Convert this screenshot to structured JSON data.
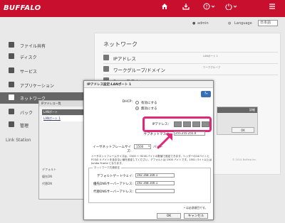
{
  "header": {
    "logo": "BUFFALO",
    "icons": [
      "home-icon",
      "download-icon",
      "help-icon",
      "power-icon"
    ],
    "user": "admin",
    "language_label": "Language",
    "language_value": "日本語"
  },
  "sidebar": {
    "items": [
      {
        "label": "ファイル共有",
        "icon": "folder-icon"
      },
      {
        "label": "ディスク",
        "icon": "disk-icon"
      },
      {
        "label": "サービス",
        "icon": "service-icon"
      },
      {
        "label": "アプリケーション",
        "icon": "app-icon"
      },
      {
        "label": "ネットワーク",
        "icon": "network-icon"
      },
      {
        "label": "バック",
        "icon": "backup-icon"
      },
      {
        "label": "管理",
        "icon": "admin-icon"
      }
    ],
    "footer": "Link Station"
  },
  "content": {
    "title": "ネットワーク",
    "rows": [
      {
        "label": "IPアドレス",
        "side": "LANポート 1",
        "icon": "ip-icon"
      },
      {
        "label": "ワークグループ/ドメイン",
        "side": "ワークグループ",
        "icon": "workgroup-icon"
      },
      {
        "label": "Proxyモスト",
        "side": "",
        "icon": "proxy-icon"
      }
    ],
    "copyright": "© 2014 Buffalo Inc."
  },
  "back_dialog": {
    "title": "IPアドレス一覧",
    "head": "LANポート",
    "row": "LANポート 1",
    "labels": [
      "デフォルト",
      "優先DN",
      "代替DN"
    ]
  },
  "right_panel": {
    "head": "詳細",
    "ok": "OK"
  },
  "dialog": {
    "title": "IPアドレス設定:LANポート 1",
    "help": "?",
    "dhcp_label": "DHCP:",
    "dhcp_enable": "有効にする",
    "dhcp_disable": "無効にする",
    "ip_label": "IPアドレス：",
    "subnet_label": "サブネットマスク：",
    "subnet_value": "255.255.255.0",
    "frame_label": "イーサネットフレームサイズ:",
    "frame_value": "1500",
    "frame_unit": "バイト",
    "description": "イーサネットフレームサイズは、1500 ～ 9216 バイトの数値で設定できます。ヘッダーの14バイトとFCSの 4 バイトを含まない値を設定してください。デフォルトは 1500 バイトです。1501 バイト以上は Jumbo Frame となります。",
    "group_legend": "ネットワーク共通設定",
    "gateway_label": "デフォルトゲートウェイ:",
    "gateway_value": "192.168.100.1",
    "dns1_label": "優先DNSサーバーアドレス:",
    "dns1_value": "192.168.100.1",
    "dns2_label": "代替DNSサーバーアドレス:",
    "dns2_value": "",
    "note": "* は必須項目です。",
    "ok": "OK",
    "cancel": "キャンセル"
  },
  "colors": {
    "brand": "#c8102e",
    "highlight": "#e0287a",
    "help_button": "#3a6fb5"
  }
}
